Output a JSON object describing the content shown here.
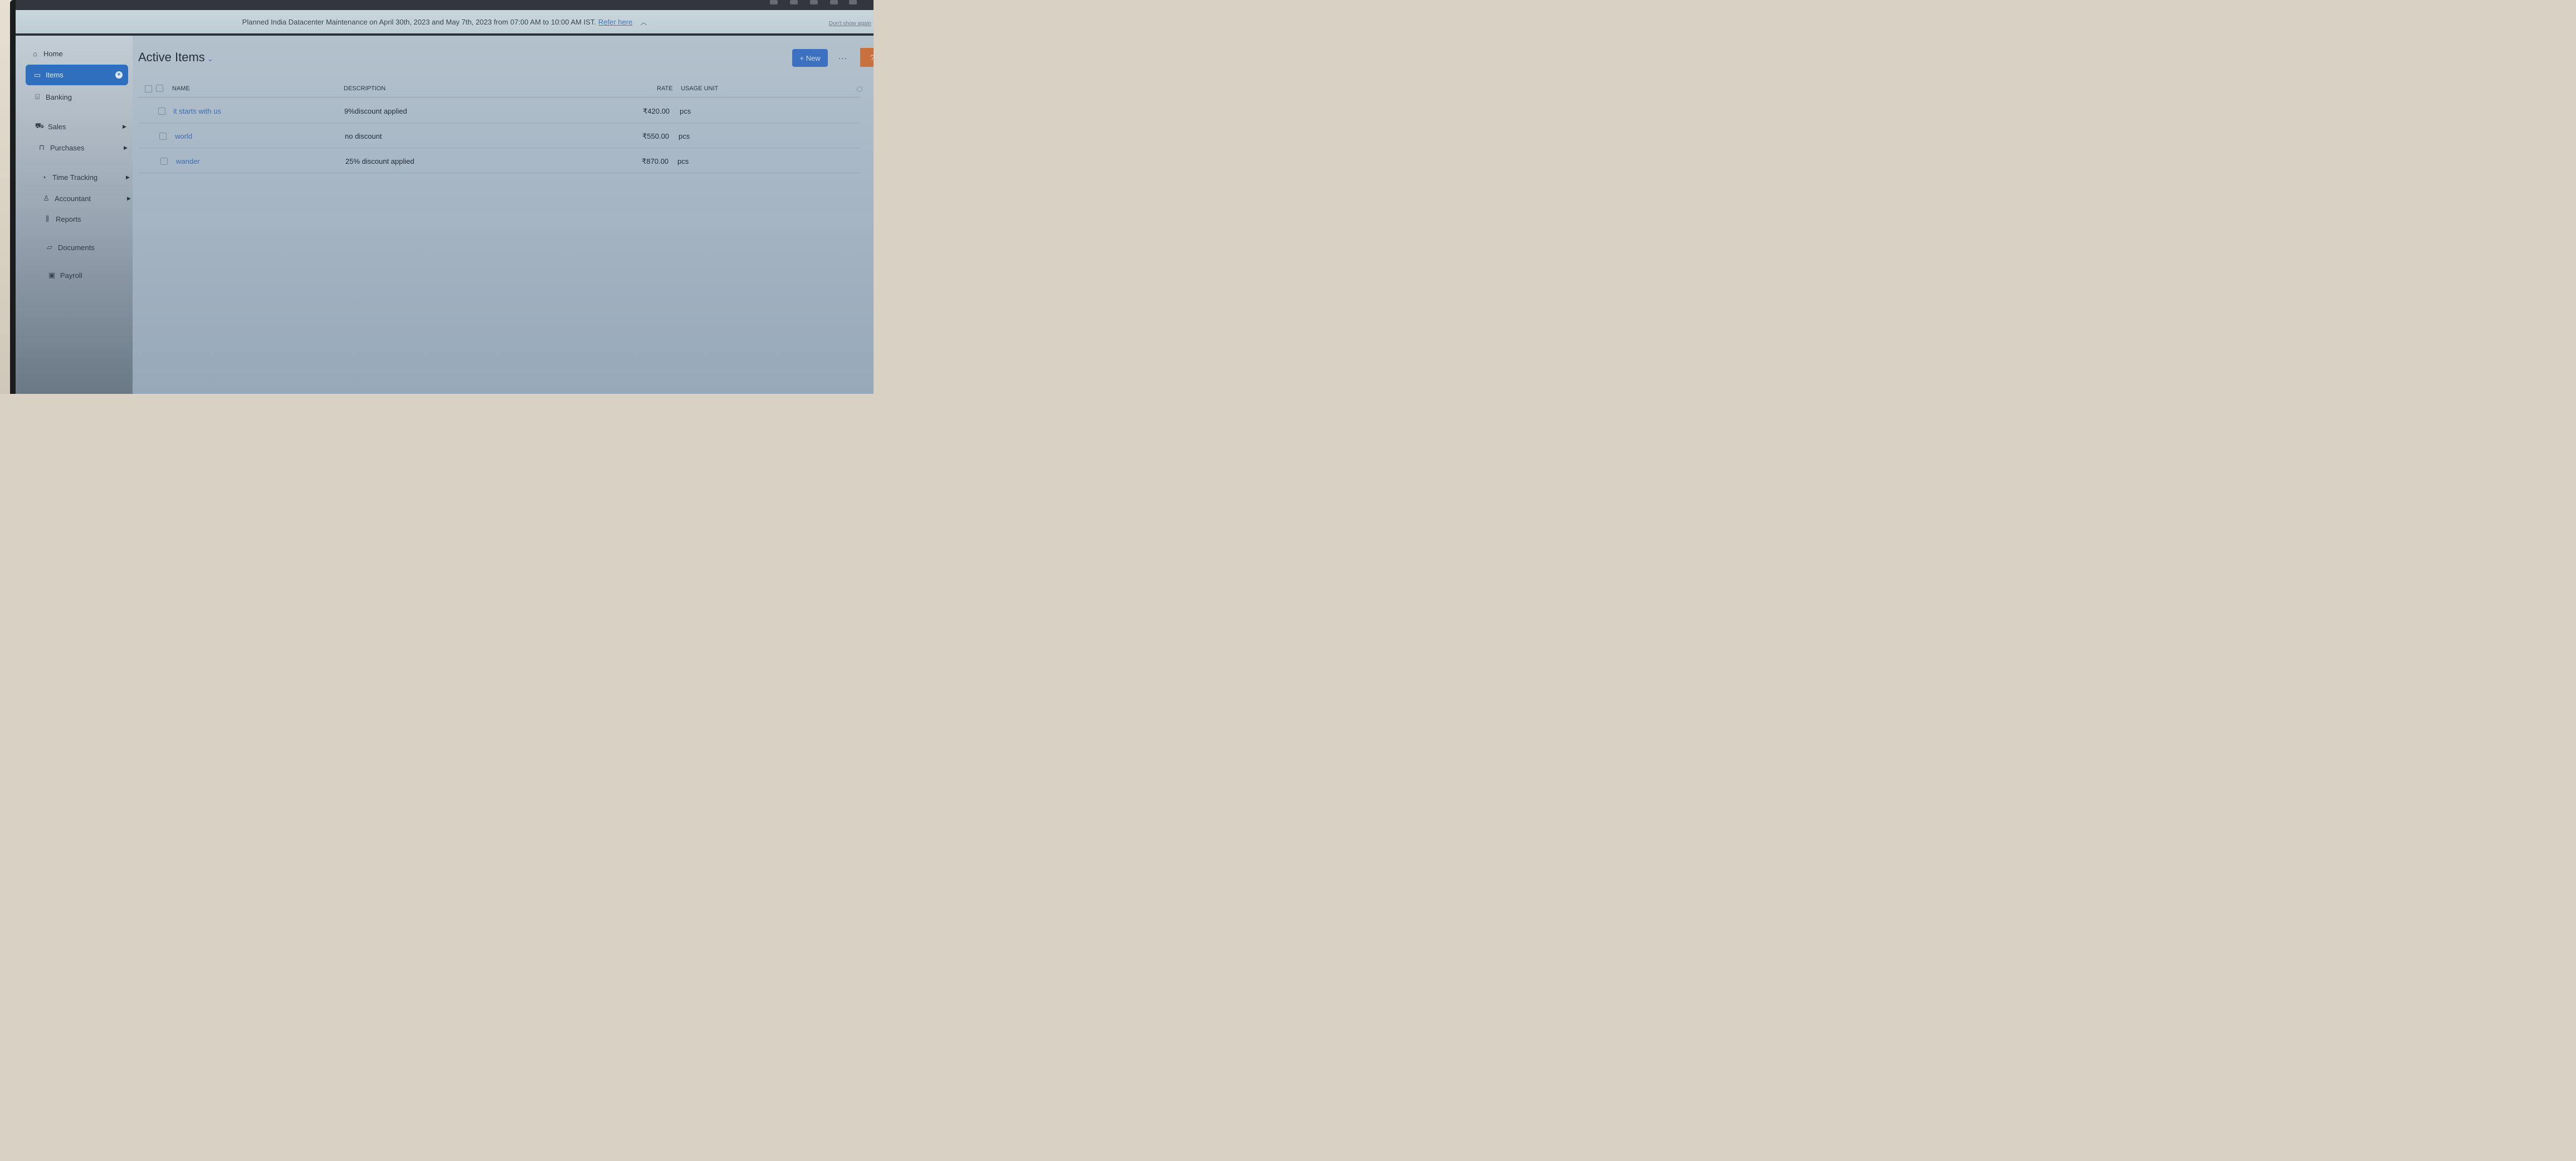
{
  "banner": {
    "message": "Planned India Datacenter Maintenance on April 30th, 2023 and May 7th, 2023 from 07:00 AM to 10:00 AM IST.",
    "link_text": "Refer here",
    "dismiss_text": "Don't show again"
  },
  "sidebar": {
    "items": [
      {
        "label": "Home",
        "icon": "home-icon"
      },
      {
        "label": "Items",
        "icon": "items-icon",
        "active": true
      },
      {
        "label": "Banking",
        "icon": "bank-icon"
      },
      {
        "label": "Sales",
        "icon": "cart-icon",
        "expandable": true
      },
      {
        "label": "Purchases",
        "icon": "bag-icon",
        "expandable": true
      },
      {
        "label": "Time Tracking",
        "icon": "timer-icon",
        "expandable": true
      },
      {
        "label": "Accountant",
        "icon": "accountant-icon",
        "expandable": true
      },
      {
        "label": "Reports",
        "icon": "reports-icon"
      },
      {
        "label": "Documents",
        "icon": "folder-icon"
      },
      {
        "label": "Payroll",
        "icon": "payroll-icon"
      }
    ]
  },
  "header": {
    "title": "Active Items",
    "new_button": "+ New",
    "more_button": "···",
    "help": "?"
  },
  "table": {
    "columns": [
      "NAME",
      "DESCRIPTION",
      "RATE",
      "USAGE UNIT"
    ],
    "rows": [
      {
        "name": "it starts with us",
        "description": "9%discount applied",
        "rate": "₹420.00",
        "unit": "pcs"
      },
      {
        "name": "world",
        "description": "no discount",
        "rate": "₹550.00",
        "unit": "pcs"
      },
      {
        "name": "wander",
        "description": "25% discount applied",
        "rate": "₹870.00",
        "unit": "pcs"
      }
    ]
  },
  "colors": {
    "accent": "#2f6fbd",
    "link": "#3d6fb3",
    "help": "#c9703f"
  }
}
